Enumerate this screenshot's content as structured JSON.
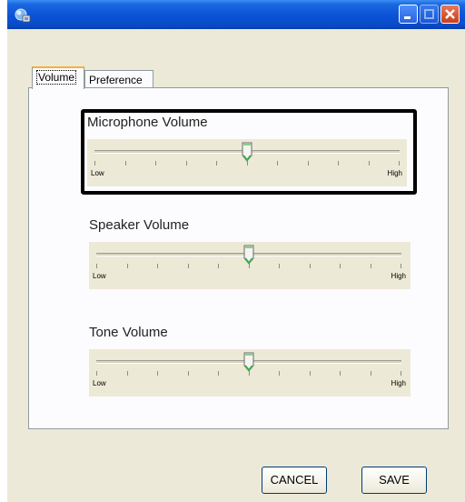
{
  "window": {
    "title": ""
  },
  "titlebar_buttons": {
    "minimize": "minimize-icon",
    "maximize": "maximize-icon",
    "close": "close-icon"
  },
  "tabs": [
    {
      "label": "Volume",
      "active": true
    },
    {
      "label": "Preference",
      "active": false
    }
  ],
  "sliders": [
    {
      "label": "Microphone Volume",
      "low_label": "Low",
      "high_label": "High",
      "value": 0.5,
      "highlighted": true
    },
    {
      "label": "Speaker Volume",
      "low_label": "Low",
      "high_label": "High",
      "value": 0.5,
      "highlighted": false
    },
    {
      "label": "Tone Volume",
      "low_label": "Low",
      "high_label": "High",
      "value": 0.5,
      "highlighted": false
    }
  ],
  "buttons": {
    "cancel": "CANCEL",
    "save": "SAVE"
  },
  "colors": {
    "titlebar": "#0a52d6",
    "window_bg": "#ece9d8",
    "tab_accent": "#f4b23a",
    "thumb_accent": "#3faa4e"
  }
}
